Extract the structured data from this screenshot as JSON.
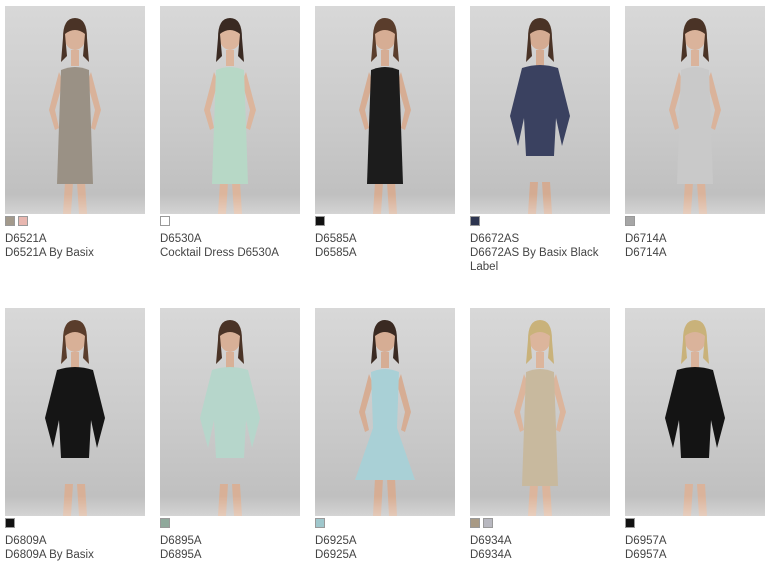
{
  "products": [
    {
      "code": "D6521A",
      "name": "D6521A By Basix",
      "swatches": [
        "#a39a8c",
        "#e8b7b0"
      ],
      "dress": "#9a9185",
      "skin": "#d9b29a",
      "hair": "#4a3326",
      "style": "vneck"
    },
    {
      "code": "D6530A",
      "name": "Cocktail Dress D6530A",
      "swatches": [
        "#ffffff"
      ],
      "dress": "#b7d8c6",
      "skin": "#dcb59c",
      "hair": "#3a2a22",
      "style": "strap"
    },
    {
      "code": "D6585A",
      "name": "D6585A",
      "swatches": [
        "#111111"
      ],
      "dress": "#1c1c1c",
      "skin": "#d6ad94",
      "hair": "#5a3d2c",
      "style": "strap"
    },
    {
      "code": "D6672AS",
      "name": "D6672AS By Basix Black Label",
      "swatches": [
        "#2d3550"
      ],
      "dress": "#3a4160",
      "skin": "#d4ab92",
      "hair": "#4a3326",
      "style": "sleeve"
    },
    {
      "code": "D6714A",
      "name": "D6714A",
      "swatches": [
        "#a6a6a6"
      ],
      "dress": "#c9c9c9",
      "skin": "#dab39b",
      "hair": "#4a3326",
      "style": "tank"
    },
    {
      "code": "D6809A",
      "name": "D6809A By Basix",
      "swatches": [
        "#111111"
      ],
      "dress": "#151515",
      "skin": "#d8b097",
      "hair": "#5a3d2c",
      "style": "sleeve"
    },
    {
      "code": "D6895A",
      "name": "D6895A",
      "swatches": [
        "#8fa89b"
      ],
      "dress": "#b6d6cb",
      "skin": "#d8b097",
      "hair": "#4a3326",
      "style": "sleeve"
    },
    {
      "code": "D6925A",
      "name": "D6925A",
      "swatches": [
        "#9fc7cc"
      ],
      "dress": "#a9d0d6",
      "skin": "#d6ad94",
      "hair": "#3a2a22",
      "style": "flare"
    },
    {
      "code": "D6934A",
      "name": "D6934A",
      "swatches": [
        "#a89a85",
        "#b8b8c0"
      ],
      "dress": "#c8b99e",
      "skin": "#dcb59c",
      "hair": "#c9b27a",
      "style": "tank"
    },
    {
      "code": "D6957A",
      "name": "D6957A",
      "swatches": [
        "#111111"
      ],
      "dress": "#141414",
      "skin": "#dab39b",
      "hair": "#c9b27a",
      "style": "sleeve"
    }
  ]
}
